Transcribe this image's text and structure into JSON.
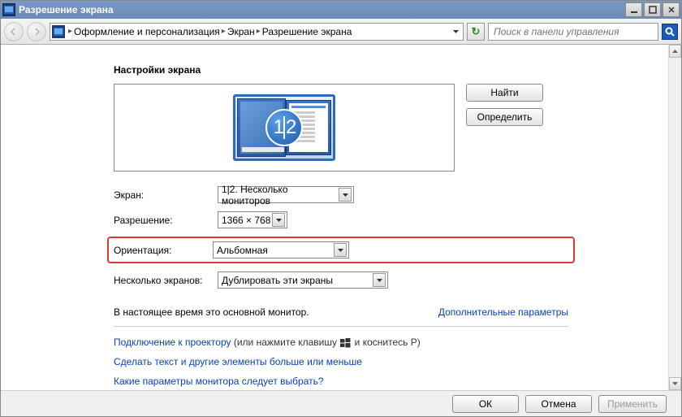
{
  "window": {
    "title": "Разрешение экрана"
  },
  "nav": {
    "crumb1": "Оформление и персонализация",
    "crumb2": "Экран",
    "crumb3": "Разрешение экрана",
    "search_placeholder": "Поиск в панели управления"
  },
  "main": {
    "heading": "Настройки экрана",
    "detect_btn": "Найти",
    "identify_btn": "Определить",
    "monitor_badge_1": "1",
    "monitor_badge_2": "2",
    "labels": {
      "display": "Экран:",
      "resolution": "Разрешение:",
      "orientation": "Ориентация:",
      "multiple": "Несколько экранов:"
    },
    "values": {
      "display": "1|2. Несколько мониторов",
      "resolution": "1366 × 768",
      "orientation": "Альбомная",
      "multiple": "Дублировать эти экраны"
    },
    "status": "В настоящее время это основной монитор.",
    "adv_link": "Дополнительные параметры",
    "projector_link": "Подключение к проектору",
    "projector_hint_a": " (или нажмите клавишу ",
    "projector_hint_b": " и коснитесь P)",
    "textsize_link": "Сделать текст и другие элементы больше или меньше",
    "whichmonitor_link": "Какие параметры монитора следует выбрать?"
  },
  "footer": {
    "ok": "ОК",
    "cancel": "Отмена",
    "apply": "Применить"
  }
}
